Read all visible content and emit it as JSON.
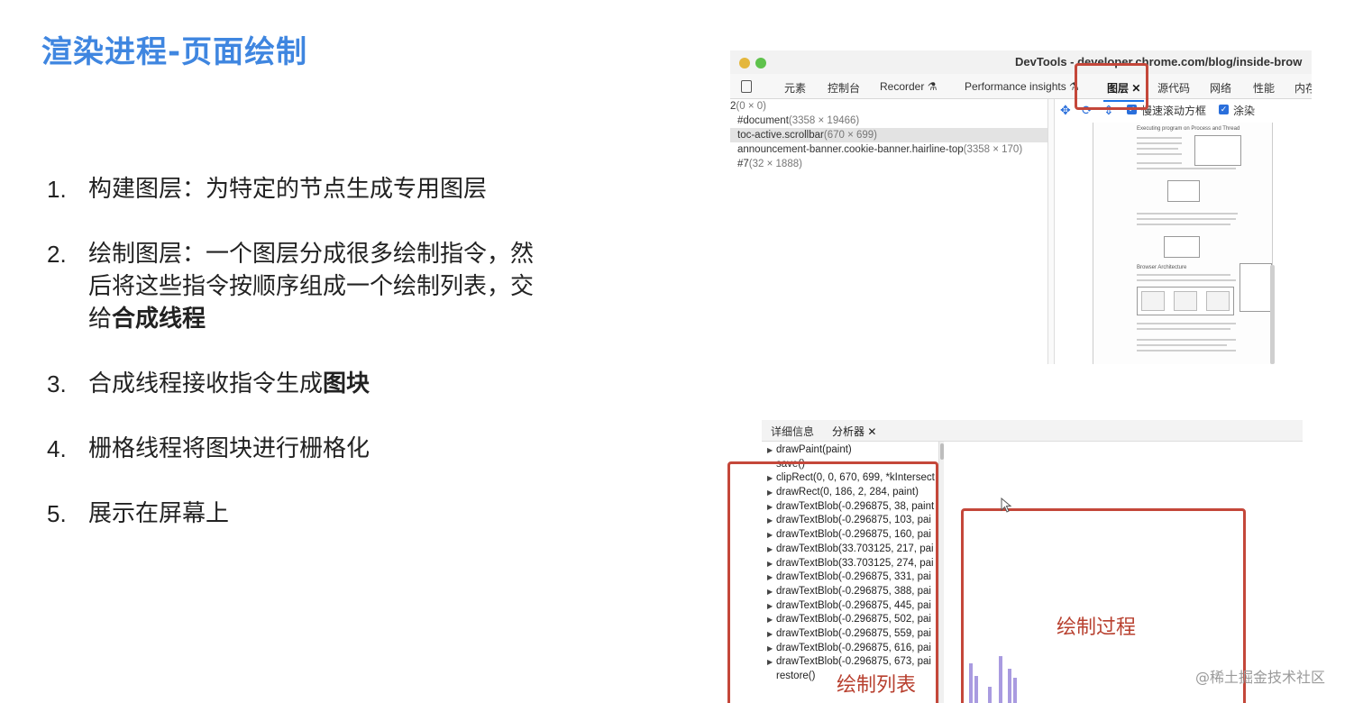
{
  "slide": {
    "title": "渲染进程-页面绘制",
    "steps": [
      {
        "num": "1.",
        "text": "构建图层：为特定的节点生成专用图层",
        "bold": ""
      },
      {
        "num": "2.",
        "text": "绘制图层：一个图层分成很多绘制指令，然后将这些指令按顺序组成一个绘制列表，交给",
        "bold": "合成线程"
      },
      {
        "num": "3.",
        "text": "合成线程接收指令生成",
        "bold": "图块"
      },
      {
        "num": "4.",
        "text": "栅格线程将图块进行栅格化",
        "bold": ""
      },
      {
        "num": "5.",
        "text": "展示在屏幕上",
        "bold": ""
      }
    ]
  },
  "devtools": {
    "window_title": "DevTools - developer.chrome.com/blog/inside-brow",
    "tabs": [
      "元素",
      "控制台",
      "Recorder ⚗",
      "Performance insights ⚗",
      "图层 ✕",
      "源代码",
      "网络",
      "性能",
      "内存"
    ],
    "active_tab": "图层 ✕",
    "layer_tree": [
      {
        "name": "2",
        "dim": "(0 × 0)",
        "selected": false,
        "root": true
      },
      {
        "name": "#document",
        "dim": "(3358 × 19466)",
        "selected": false,
        "root": false
      },
      {
        "name": "toc-active.scrollbar",
        "dim": "(670 × 699)",
        "selected": true,
        "root": false
      },
      {
        "name": "announcement-banner.cookie-banner.hairline-top",
        "dim": "(3358 × 170)",
        "selected": false,
        "root": false
      },
      {
        "name": "#7",
        "dim": "(32 × 1888)",
        "selected": false,
        "root": false
      }
    ],
    "toolbar": {
      "pan_icon": "move-icon",
      "rotate_icon": "rotate-icon",
      "reset_icon": "reset-icon",
      "slow_scroll_label": "慢速滚动方框",
      "paints_label": "涂染"
    },
    "preview": {
      "heading1": "Executing program on Process and Thread",
      "heading2": "Browser Architecture"
    }
  },
  "analyzer": {
    "tabs": [
      "详细信息",
      "分析器 ✕"
    ],
    "active_tab": "分析器 ✕",
    "commands": [
      {
        "text": "drawPaint(paint)",
        "expandable": true
      },
      {
        "text": "save()",
        "expandable": false
      },
      {
        "text": "clipRect(0, 0, 670, 699, *kIntersect",
        "expandable": true
      },
      {
        "text": "drawRect(0, 186, 2, 284, paint)",
        "expandable": true
      },
      {
        "text": "drawTextBlob(-0.296875, 38, paint",
        "expandable": true
      },
      {
        "text": "drawTextBlob(-0.296875, 103, pai",
        "expandable": true
      },
      {
        "text": "drawTextBlob(-0.296875, 160, pai",
        "expandable": true
      },
      {
        "text": "drawTextBlob(33.703125, 217, pai",
        "expandable": true
      },
      {
        "text": "drawTextBlob(33.703125, 274, pai",
        "expandable": true
      },
      {
        "text": "drawTextBlob(-0.296875, 331, pai",
        "expandable": true
      },
      {
        "text": "drawTextBlob(-0.296875, 388, pai",
        "expandable": true
      },
      {
        "text": "drawTextBlob(-0.296875, 445, pai",
        "expandable": true
      },
      {
        "text": "drawTextBlob(-0.296875, 502, pai",
        "expandable": true
      },
      {
        "text": "drawTextBlob(-0.296875, 559, pai",
        "expandable": true
      },
      {
        "text": "drawTextBlob(-0.296875, 616, pai",
        "expandable": true
      },
      {
        "text": "drawTextBlob(-0.296875, 673, pai",
        "expandable": true
      },
      {
        "text": "restore()",
        "expandable": false
      }
    ]
  },
  "annotations": {
    "draw_list_label": "绘制列表",
    "draw_process_label": "绘制过程",
    "highlight_color": "#c4473a"
  },
  "watermark": "@稀土掘金技术社区"
}
